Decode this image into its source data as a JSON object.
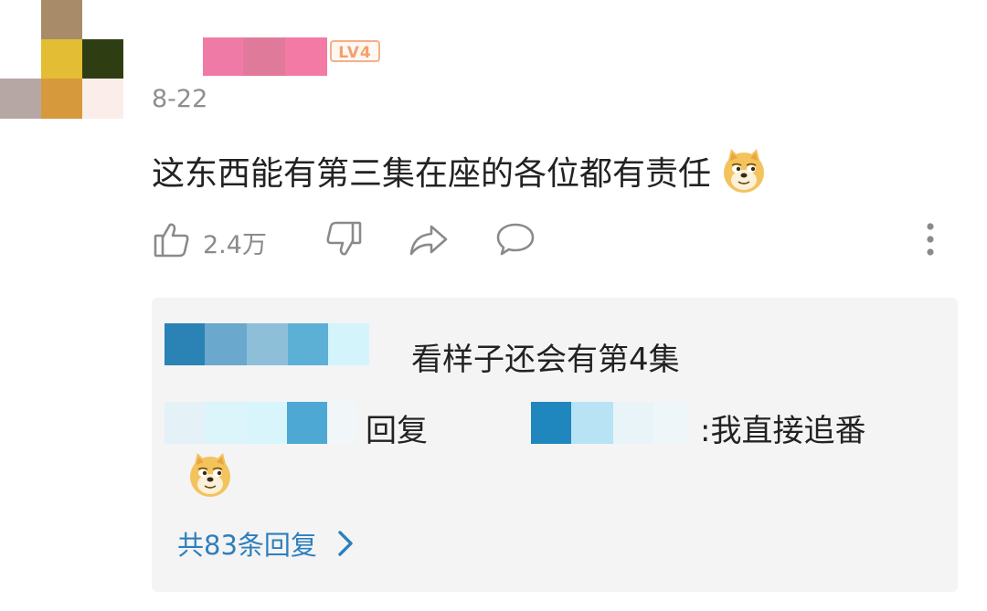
{
  "comment": {
    "level_badge": "LV4",
    "date": "8-22",
    "text": "这东西能有第三集在座的各位都有责任",
    "emoji_icon": "doge-emoji-icon",
    "like_count": "2.4万"
  },
  "actions": {
    "like_icon": "thumbs-up-icon",
    "dislike_icon": "thumbs-down-icon",
    "share_icon": "share-arrow-icon",
    "reply_icon": "speech-bubble-icon",
    "more_icon": "more-vertical-icon"
  },
  "replies": {
    "items": [
      {
        "text": "看样子还会有第4集"
      },
      {
        "reply_label": "回复",
        "text": ":我直接追番"
      }
    ],
    "more_label": "共83条回复"
  },
  "colors": {
    "accent_link": "#2d7fbd",
    "level_badge": "#f3a070",
    "text_primary": "#222222",
    "text_secondary": "#8e8e8e",
    "reply_bg": "#f4f4f4"
  }
}
